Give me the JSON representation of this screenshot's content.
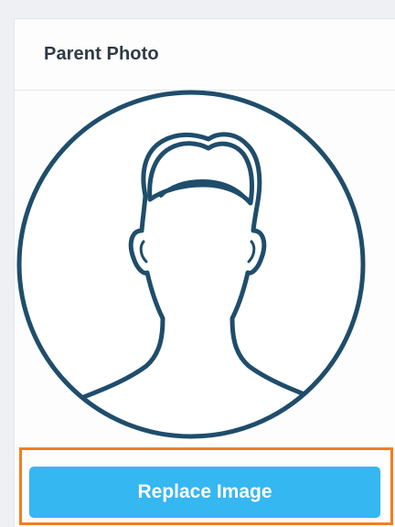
{
  "card": {
    "title": "Parent Photo"
  },
  "avatar": {
    "icon": "user-placeholder-icon",
    "stroke_color": "#1f4d6b"
  },
  "actions": {
    "replace_label": "Replace Image",
    "button_color": "#35b7f2",
    "highlight_color": "#f07f23"
  }
}
